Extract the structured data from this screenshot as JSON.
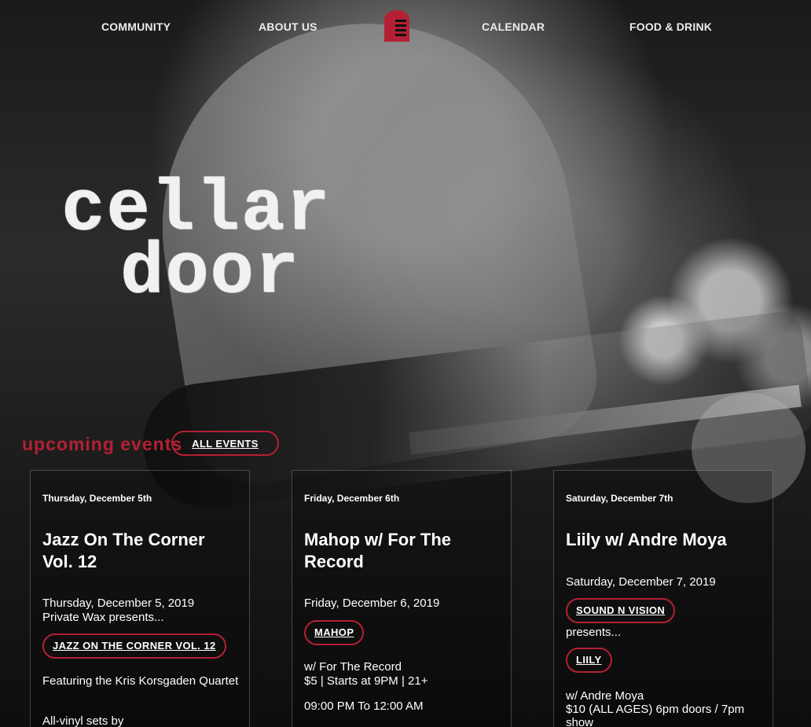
{
  "nav": {
    "community": "COMMUNITY",
    "about": "ABOUT US",
    "calendar": "CALENDAR",
    "food": "FOOD & DRINK"
  },
  "hero": {
    "line1": "cellar",
    "line2": "door"
  },
  "events": {
    "heading": "upcoming events",
    "all_label": "ALL EVENTS",
    "items": [
      {
        "day_label": "Thursday, December 5th",
        "title": "Jazz On The Corner Vol. 12",
        "date": "Thursday, December 5, 2019",
        "presenter": "Private Wax presents...",
        "tag": "JAZZ ON THE CORNER VOL. 12",
        "detail": "Featuring the Kris Korsgaden Quartet",
        "extra": "All-vinyl sets by"
      },
      {
        "day_label": "Friday, December 6th",
        "title": "Mahop w/ For The Record",
        "date": "Friday, December 6, 2019",
        "tag": "MAHOP",
        "detail1": "w/ For The Record",
        "detail2": "$5 | Starts at 9PM | 21+",
        "time": "09:00 PM To 12:00 AM"
      },
      {
        "day_label": "Saturday, December 7th",
        "title": "Liily w/ Andre Moya",
        "date": "Saturday, December 7, 2019",
        "tag1": "SOUND N VISION",
        "presents": "presents...",
        "tag2": "LIILY",
        "detail1": "w/ Andre Moya",
        "detail2": "$10 (ALL AGES) 6pm doors / 7pm",
        "detail3": "show"
      }
    ]
  },
  "icons": {
    "logo": "door-logo-icon"
  },
  "colors": {
    "accent": "#b42033",
    "text": "#ffffff"
  }
}
